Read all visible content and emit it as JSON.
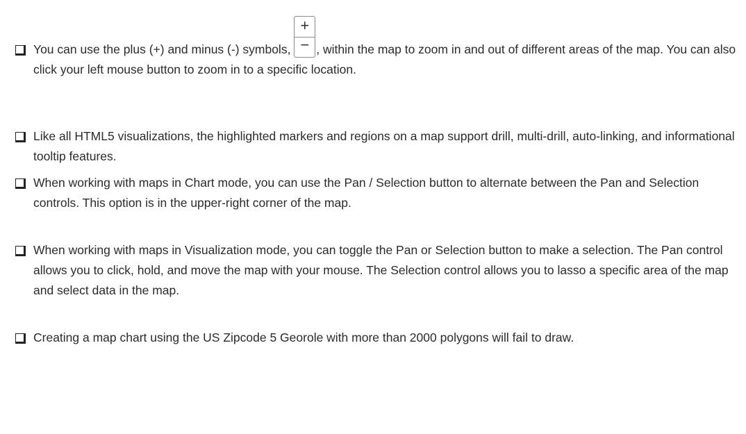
{
  "items": [
    {
      "before_icon": "You can use the plus (+) and minus (-) symbols, ",
      "after_icon": ", within the map to zoom in and out of different areas of the map. You can also click your left mouse button to zoom in to a specific location.",
      "zoom_control": {
        "plus": "+",
        "minus": "−"
      }
    },
    {
      "text": "Like all HTML5 visualizations, the highlighted markers and regions on a map support drill, multi-drill, auto-linking, and informational tooltip features."
    },
    {
      "text": "When working with maps in Chart mode, you can use the Pan / Selection button to alternate between the Pan and Selection controls. This option is in the upper-right corner of the map."
    },
    {
      "text": "When working with maps in Visualization mode, you can toggle the Pan or Selection button to make a selection. The Pan control allows you to click, hold, and move the map with your mouse. The Selection control allows you to lasso a specific area of the map and select data in the map."
    },
    {
      "text": "Creating a map chart using the US Zipcode 5 Georole with more than 2000 polygons will fail to draw."
    }
  ],
  "icon": "checkbox-bullet-icon"
}
